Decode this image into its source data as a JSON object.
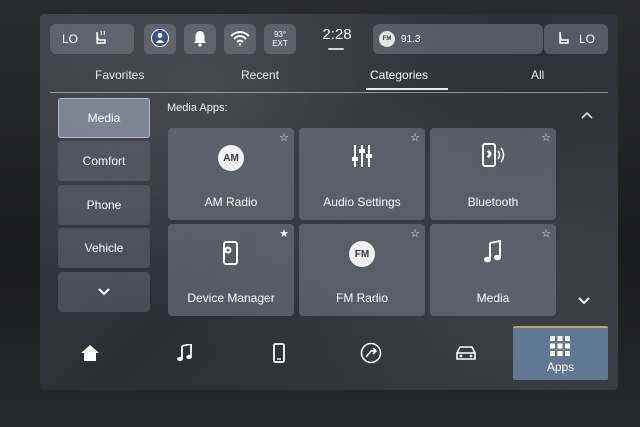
{
  "status": {
    "left_climate": "LO",
    "right_climate": "LO",
    "temperature_value": "93°",
    "temperature_label": "EXT",
    "time": "2:28",
    "radio_badge": "FM",
    "radio_station": "91.3"
  },
  "tabs": [
    {
      "label": "Favorites"
    },
    {
      "label": "Recent"
    },
    {
      "label": "Categories"
    },
    {
      "label": "All"
    }
  ],
  "sidenav": [
    {
      "label": "Media"
    },
    {
      "label": "Comfort"
    },
    {
      "label": "Phone"
    },
    {
      "label": "Vehicle"
    }
  ],
  "section_title": "Media Apps:",
  "tiles": [
    {
      "label": "AM Radio",
      "badge": "AM",
      "icon": "am-radio-icon"
    },
    {
      "label": "Audio Settings",
      "icon": "equalizer-icon"
    },
    {
      "label": "Bluetooth",
      "icon": "bluetooth-phone-icon"
    },
    {
      "label": "Device Manager",
      "icon": "device-manager-icon"
    },
    {
      "label": "FM Radio",
      "badge": "FM",
      "icon": "fm-radio-icon"
    },
    {
      "label": "Media",
      "icon": "music-note-icon"
    }
  ],
  "dock": {
    "apps_label": "Apps"
  },
  "colors": {
    "accent": "#c9a34b",
    "apps_tile": "#82aad7"
  }
}
